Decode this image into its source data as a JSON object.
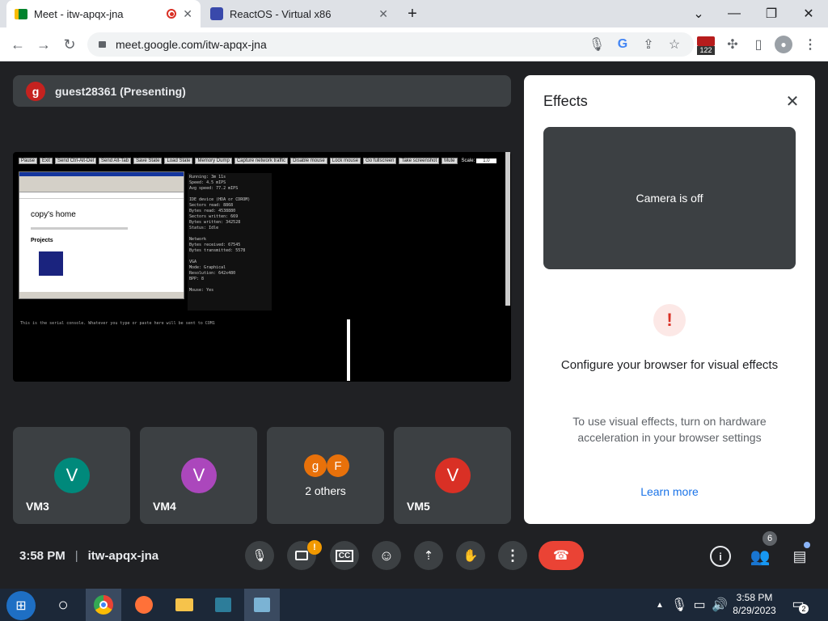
{
  "browser": {
    "tabs": [
      {
        "label": "Meet - itw-apqx-jna",
        "icon": "meet-icon"
      },
      {
        "label": "ReactOS - Virtual x86",
        "icon": "reactos-icon"
      }
    ],
    "url": "meet.google.com/itw-apqx-jna",
    "ext_badge": "122"
  },
  "presenter": {
    "initial": "g",
    "label": "guest28361 (Presenting)"
  },
  "screenshare": {
    "toolbar": [
      "Pause",
      "Exit",
      "Send Ctrl-Alt-Del",
      "Send Alt-Tab",
      "Save State",
      "Load State",
      "Memory Dump",
      "Capture network traffic",
      "Disable mouse",
      "Lock mouse",
      "Go fullscreen",
      "Take screenshot",
      "Mute"
    ],
    "scale_label": "Scale:",
    "scale_value": "1.0",
    "page_heading": "copy's home",
    "page_projects": "Projects",
    "stats": [
      "Running: 3m 11s",
      "Speed: 4.5 mIPS",
      "Avg speed: 77.2 mIPS",
      "",
      "IDE device (HDA or CDROM)",
      "Sectors read: 8868",
      "Bytes read: 4538880",
      "Sectors written: 669",
      "Bytes written: 342528",
      "Status: Idle",
      "",
      "Network",
      "Bytes received: 67545",
      "Bytes transmitted: 5578",
      "",
      "VGA",
      "Mode: Graphical",
      "Resolution: 642x480",
      "BPP: 8",
      "",
      "Mouse: Yes"
    ],
    "console_text": "This is the serial console. Whatever you type or paste here will be sent to COM1"
  },
  "participants": [
    {
      "name": "VM3",
      "initial": "V",
      "color": "#00897b"
    },
    {
      "name": "VM4",
      "initial": "V",
      "color": "#ab47bc"
    },
    {
      "name": "2 others",
      "initials": [
        "g",
        "F"
      ],
      "colors": [
        "#e8710a",
        "#e8710a"
      ]
    },
    {
      "name": "VM5",
      "initial": "V",
      "color": "#d93025"
    }
  ],
  "effects": {
    "title": "Effects",
    "camera_off": "Camera is off",
    "heading": "Configure your browser for visual effects",
    "body": "To use visual effects, turn on hardware acceleration in your browser settings",
    "link": "Learn more"
  },
  "bottom": {
    "time": "3:58 PM",
    "code": "itw-apqx-jna",
    "participant_count": "6"
  },
  "taskbar": {
    "time": "3:58 PM",
    "date": "8/29/2023",
    "notif_count": "2"
  }
}
